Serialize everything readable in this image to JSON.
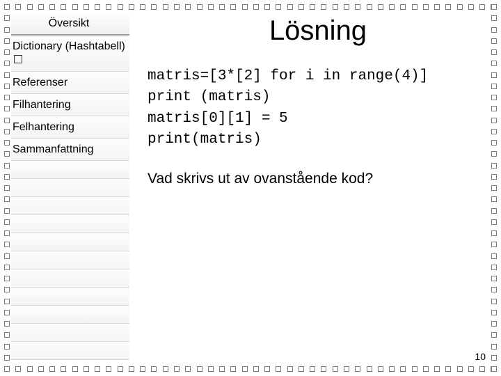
{
  "sidebar": {
    "items": [
      {
        "label": "Översikt"
      },
      {
        "label": "Dictionary (Hashtabell)",
        "has_box": true
      },
      {
        "label": "Referenser"
      },
      {
        "label": "Filhantering"
      },
      {
        "label": "Felhantering"
      },
      {
        "label": "Sammanfattning"
      }
    ]
  },
  "main": {
    "title": "Lösning",
    "code_lines": [
      "matris=[3*[2] for i in range(4)]",
      "print (matris)",
      "matris[0][1] = 5",
      "print(matris)"
    ],
    "question": "Vad skrivs ut av ovanstående kod?"
  },
  "page_number": "10"
}
